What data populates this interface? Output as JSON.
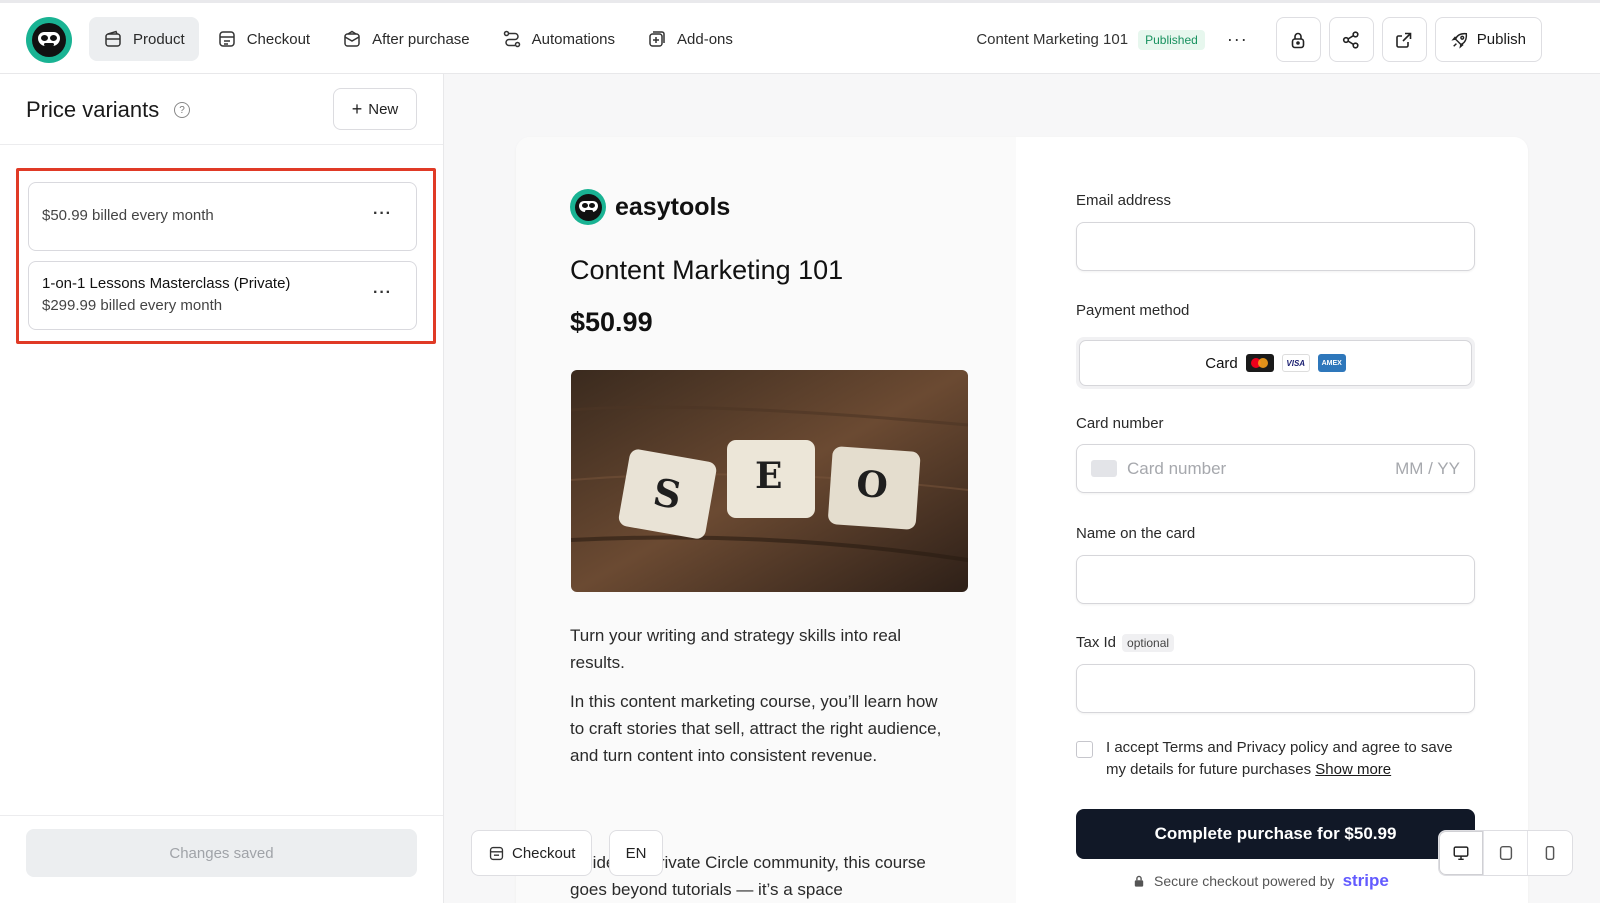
{
  "nav": {
    "items": [
      {
        "label": "Product",
        "icon": "wallet-icon",
        "active": true
      },
      {
        "label": "Checkout",
        "icon": "checkout-icon",
        "active": false
      },
      {
        "label": "After purchase",
        "icon": "mail-icon",
        "active": false
      },
      {
        "label": "Automations",
        "icon": "automations-icon",
        "active": false
      },
      {
        "label": "Add-ons",
        "icon": "addons-icon",
        "active": false
      }
    ],
    "product_name": "Content Marketing 101",
    "status_badge": "Published",
    "more": "···",
    "publish_label": "Publish"
  },
  "sidebar": {
    "title": "Price variants",
    "help": "?",
    "new_label": "New",
    "variants": [
      {
        "title": "",
        "subtitle": "$50.99 billed every month"
      },
      {
        "title": "1-on-1 Lessons Masterclass (Private)",
        "subtitle": "$299.99 billed every month"
      }
    ],
    "variant_menu": "···",
    "saved_label": "Changes saved"
  },
  "preview": {
    "brand": "easytools",
    "title": "Content Marketing 101",
    "price": "$50.99",
    "image_letters": [
      "S",
      "E",
      "O"
    ],
    "desc1": "Turn your writing and strategy skills into real results.",
    "desc2": "In this content marketing course, you’ll learn how to craft stories that sell, attract the right audience, and turn content into consistent revenue.",
    "desc3": "Inside our private Circle community, this course goes beyond tutorials — it’s a space",
    "form": {
      "email_label": "Email address",
      "payment_label": "Payment method",
      "card_option": "Card",
      "card_brands": [
        "VISA",
        "AMEX"
      ],
      "card_number_label": "Card number",
      "card_number_placeholder": "Card number",
      "expiry_placeholder": "MM / YY",
      "name_label": "Name on the card",
      "tax_label": "Tax Id",
      "tax_optional": "optional",
      "terms_text": "I accept Terms and Privacy policy and agree to save my details for future purchases",
      "show_more": "Show more",
      "complete_label": "Complete purchase for $50.99",
      "secure_text": "Secure checkout powered by",
      "stripe": "stripe"
    }
  },
  "floating": {
    "checkout_label": "Checkout",
    "lang": "EN",
    "devices": [
      "desktop-icon",
      "tablet-icon",
      "mobile-icon"
    ]
  },
  "colors": {
    "brand": "#19b393",
    "highlight": "#e03a26",
    "primary_button": "#111827",
    "published": "#18915f"
  }
}
